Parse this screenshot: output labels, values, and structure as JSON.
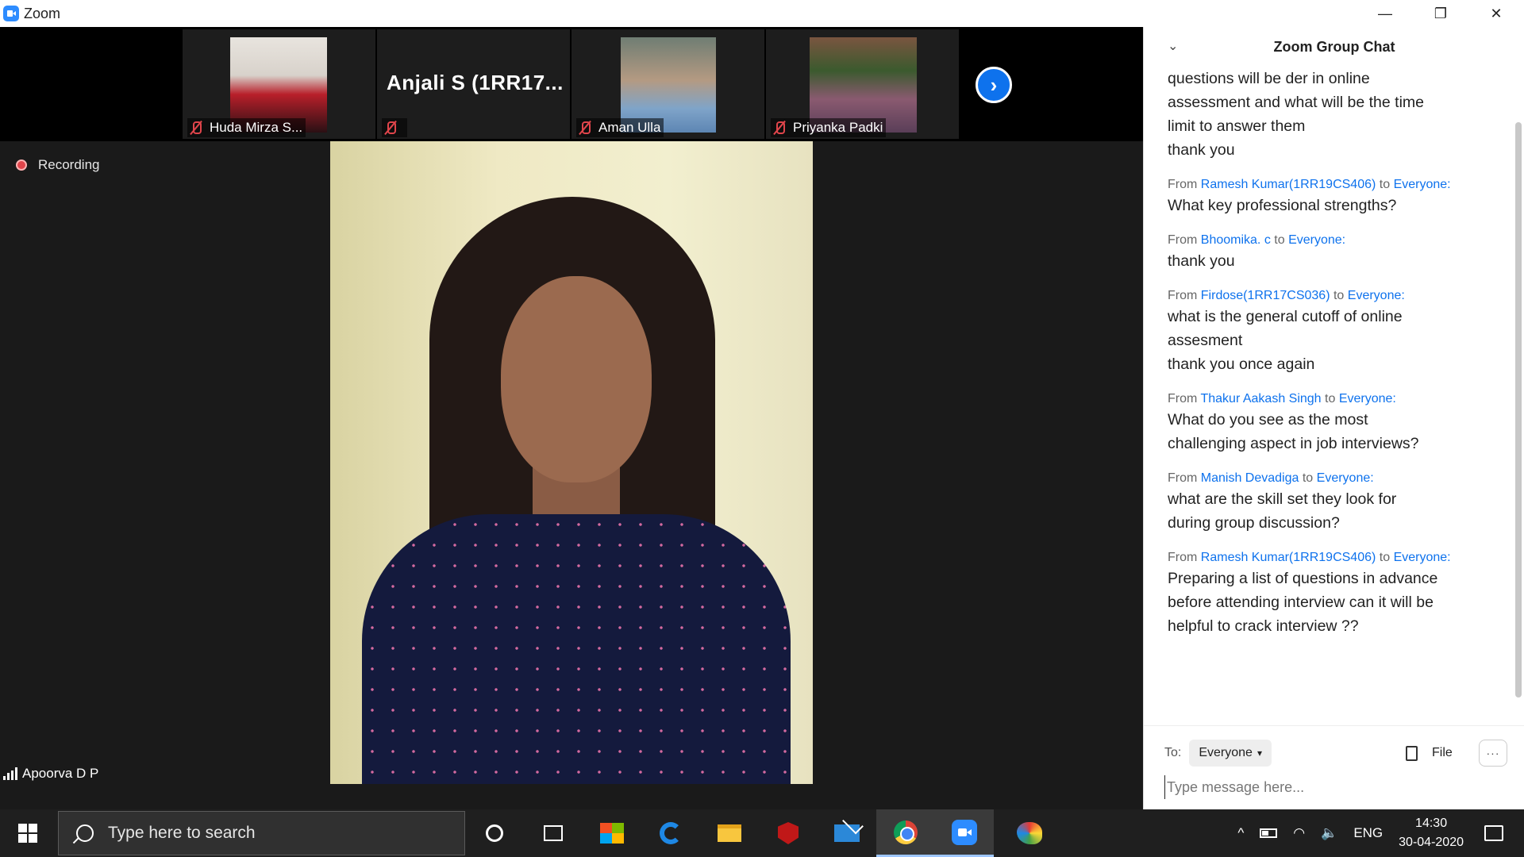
{
  "window": {
    "title": "Zoom",
    "controls": {
      "minimize": "—",
      "restore": "❐",
      "close": "✕"
    }
  },
  "meeting": {
    "participants": [
      {
        "name": "Huda Mirza S...",
        "muted": true,
        "has_video": true
      },
      {
        "name": "",
        "big_name": "Anjali S (1RR17...",
        "muted": true,
        "has_video": false
      },
      {
        "name": "Aman Ulla",
        "muted": true,
        "has_video": true
      },
      {
        "name": "Priyanka Padki",
        "muted": true,
        "has_video": true
      }
    ],
    "next_arrow": "›",
    "recording_label": "Recording",
    "active_speaker": "Apoorva D P"
  },
  "chat": {
    "title": "Zoom Group Chat",
    "collapse_icon": "⌄",
    "messages": [
      {
        "from": "",
        "to": "",
        "text": "questions will be der in online\nassessment and what will be the time\nlimit to answer them\nthank you"
      },
      {
        "from": "Ramesh Kumar(1RR19CS406)",
        "to": "Everyone:",
        "text": "What key  professional strengths?"
      },
      {
        "from": "Bhoomika. c",
        "to": "Everyone:",
        "text": "thank you"
      },
      {
        "from": "Firdose(1RR17CS036)",
        "to": "Everyone:",
        "text": "what is the general cutoff of online\nassesment\nthank you once again"
      },
      {
        "from": "Thakur Aakash Singh",
        "to": "Everyone:",
        "text": "What do you see as the most\nchallenging aspect in job interviews?"
      },
      {
        "from": "Manish Devadiga",
        "to": "Everyone:",
        "text": "what are the skill set they look for\nduring group discussion?"
      },
      {
        "from": "Ramesh Kumar(1RR19CS406)",
        "to": "Everyone:",
        "text": "Preparing a list of questions in advance\nbefore attending interview  can it will be\nhelpful to crack interview ??"
      }
    ],
    "from_word": "From",
    "to_word": "to",
    "to_label": "To:",
    "recipient": "Everyone",
    "file_label": "File",
    "more_label": "···",
    "input_placeholder": "Type message here..."
  },
  "taskbar": {
    "search_placeholder": "Type here to search",
    "apps": [
      "cortana-icon",
      "task-view-icon",
      "store-icon",
      "edge-icon",
      "file-explorer-icon",
      "mcafee-icon",
      "mail-icon",
      "chrome-icon",
      "zoom-icon",
      "paint-icon"
    ],
    "tray": {
      "chevron": "^",
      "wifi": "◠",
      "volume": "🔈",
      "language": "ENG",
      "time": "14:30",
      "date": "30-04-2020"
    }
  }
}
